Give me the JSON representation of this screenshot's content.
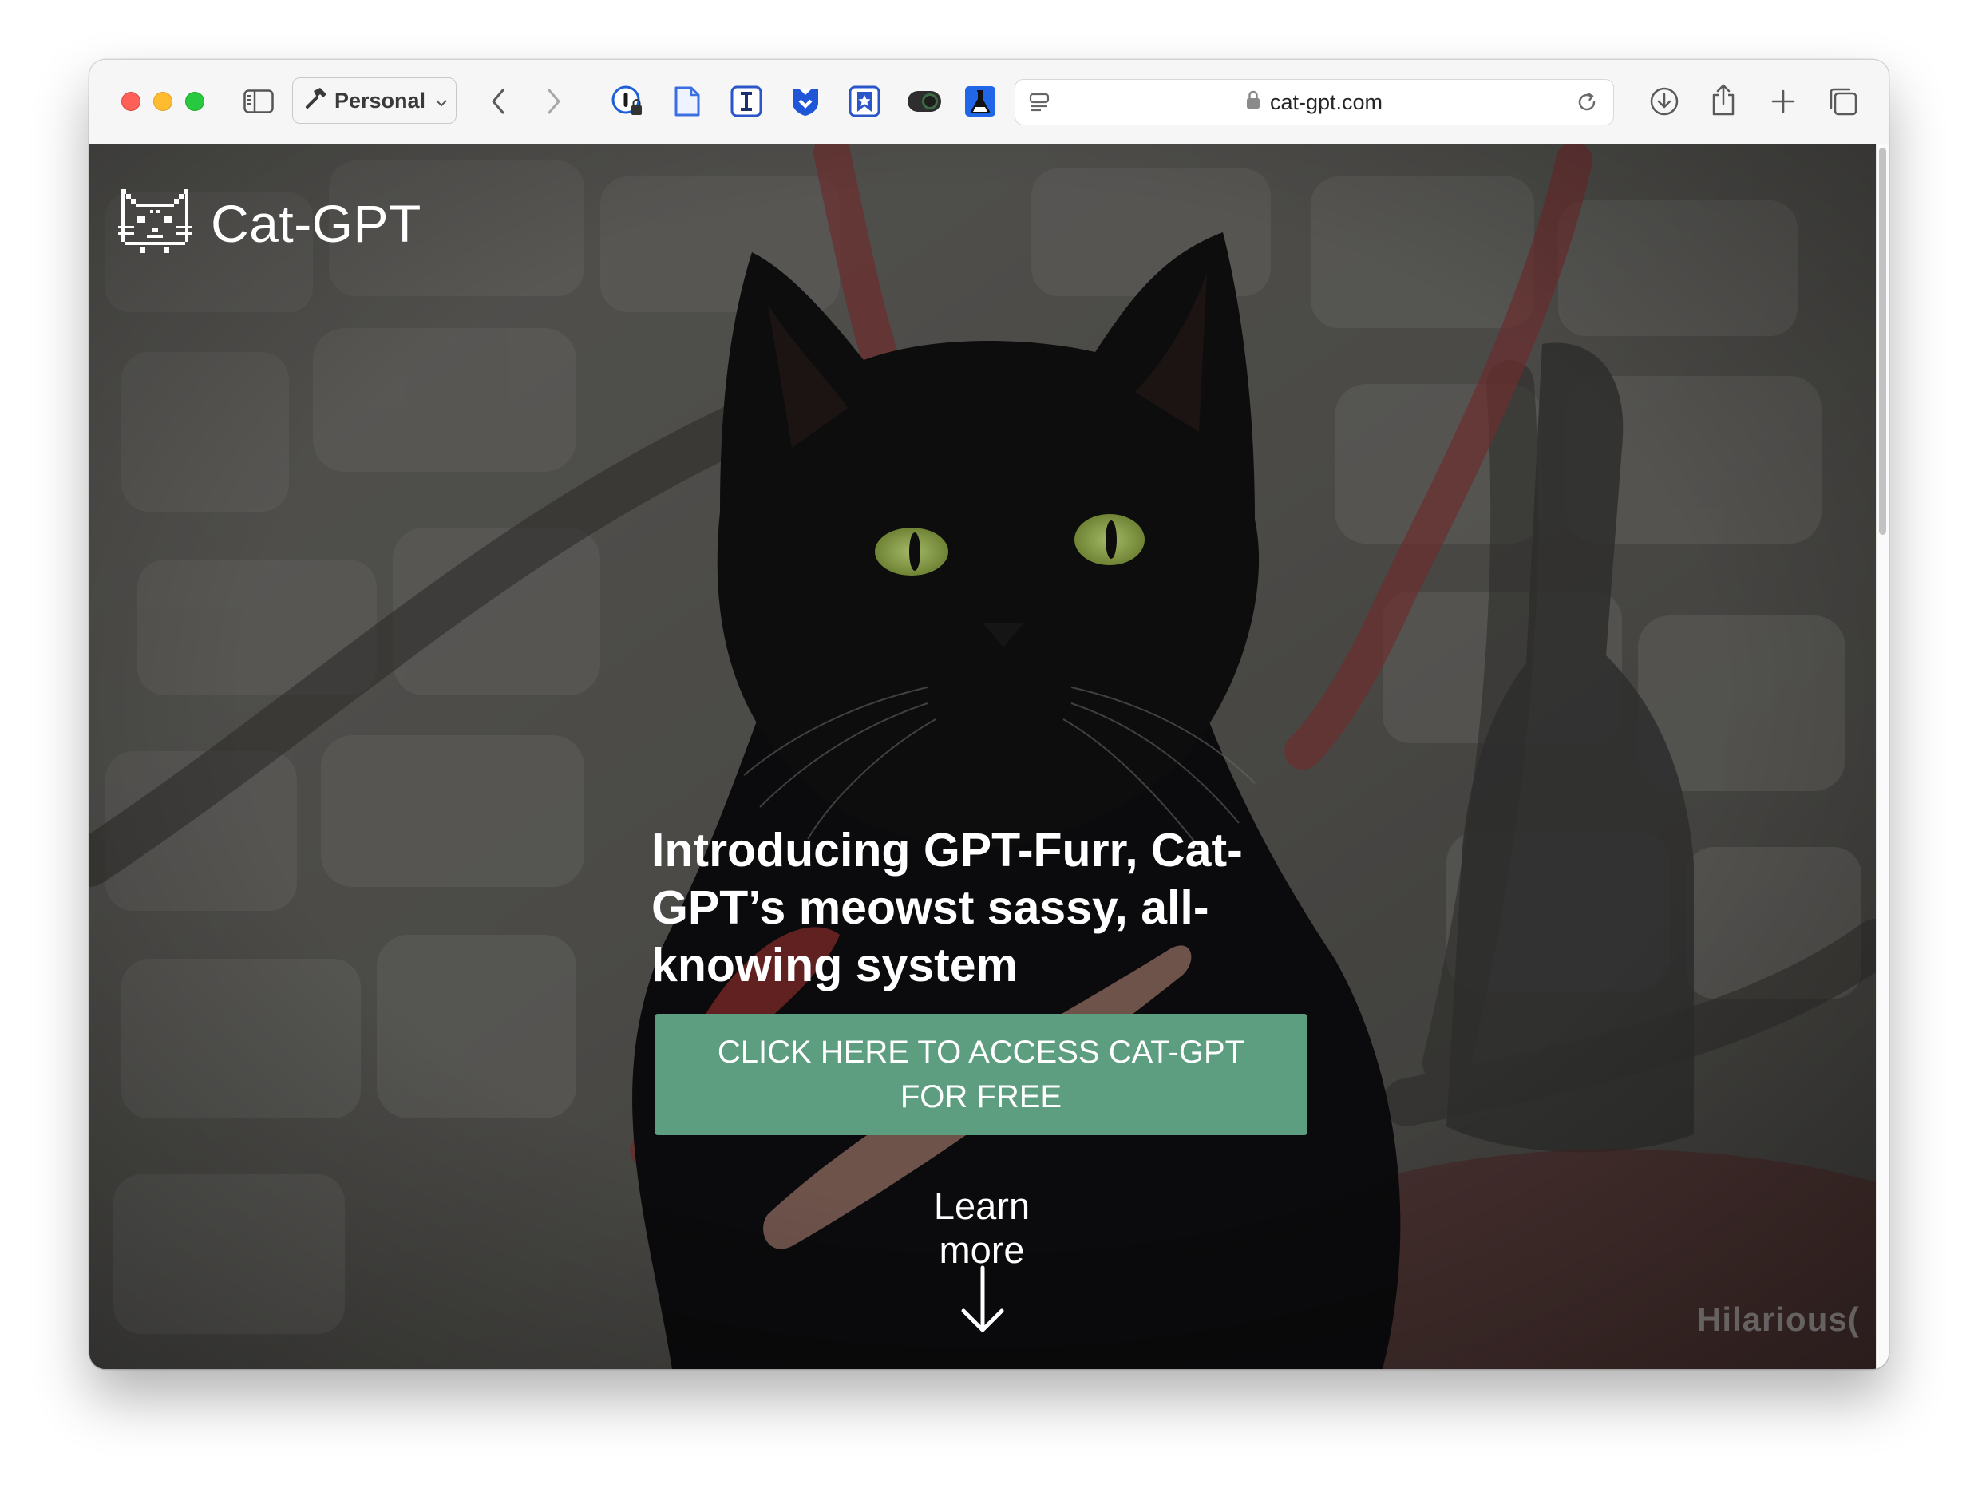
{
  "browser": {
    "profile_label": "Personal",
    "url": "cat-gpt.com",
    "extensions": [
      "onepassword-icon",
      "document-icon",
      "instapaper-icon",
      "shield-icon",
      "bookmark-icon",
      "toggle-icon",
      "flask-icon"
    ]
  },
  "site": {
    "brand_name": "Cat-GPT",
    "headline": "Introducing GPT-Furr, Cat-GPT’s meowst sassy, all-knowing system",
    "cta_label": "CLICK HERE TO ACCESS CAT-GPT FOR FREE",
    "learn_more_label": "Learn more",
    "watermark": "Hilarious("
  },
  "colors": {
    "cta_green": "#5e9e80",
    "close": "#fe5f57",
    "minimize": "#febc2e",
    "zoom": "#28c840"
  }
}
